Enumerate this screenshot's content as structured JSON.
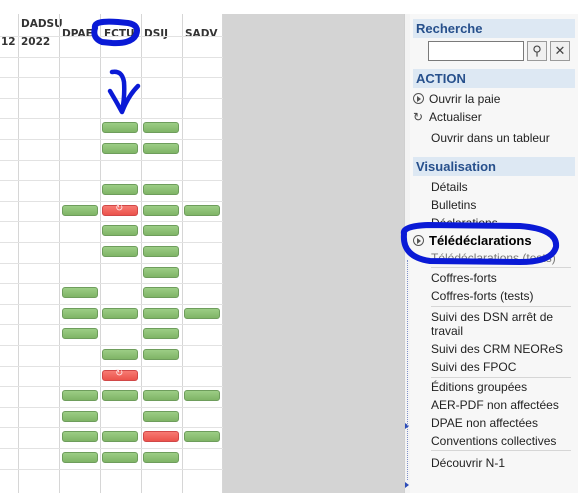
{
  "grid": {
    "headers": [
      {
        "lines": [
          "12"
        ]
      },
      {
        "lines": [
          "DADSU",
          "2022"
        ]
      },
      {
        "lines": [
          "DPAE"
        ]
      },
      {
        "lines": [
          "FCTU"
        ]
      },
      {
        "lines": [
          "DSIJ"
        ]
      },
      {
        "lines": [
          "SADV"
        ]
      }
    ]
  },
  "panel": {
    "recherche": "Recherche",
    "search_placeholder": "",
    "action": "ACTION",
    "actions": [
      "Ouvrir la paie",
      "Actualiser",
      "Ouvrir dans un tableur"
    ],
    "visualisation": "Visualisation",
    "items": [
      "Détails",
      "Bulletins",
      "Déclarations",
      "Télédéclarations",
      "Télédéclarations (tests)",
      "Coffres-forts",
      "Coffres-forts (tests)",
      "Suivi des DSN arrêt de",
      "travail",
      "Suivi des CRM NEOReS",
      "Suivi des FPOC",
      "Éditions groupées",
      "AER-PDF non affectées",
      "DPAE non affectées",
      "Conventions collectives",
      "Découvrir N-1"
    ]
  },
  "colors": {
    "ok": "#8cc275",
    "error": "#ef5b53",
    "section_bg": "#dde8f3",
    "annotation": "#0a1ad6"
  }
}
